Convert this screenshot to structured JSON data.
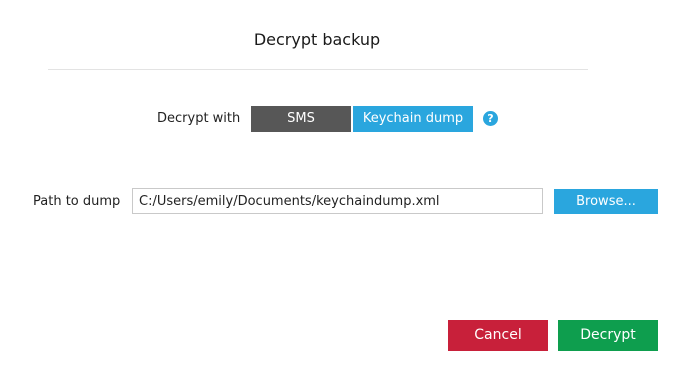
{
  "dialog": {
    "title": "Decrypt backup"
  },
  "decrypt_with": {
    "label": "Decrypt with",
    "options": [
      {
        "label": "SMS",
        "selected": false
      },
      {
        "label": "Keychain dump",
        "selected": true
      }
    ],
    "help_icon": "question-mark-icon",
    "help_glyph": "?"
  },
  "path": {
    "label": "Path to dump",
    "value": "C:/Users/emily/Documents/keychaindump.xml",
    "browse_label": "Browse..."
  },
  "footer": {
    "cancel_label": "Cancel",
    "decrypt_label": "Decrypt"
  },
  "colors": {
    "accent_blue": "#2aa6de",
    "segment_inactive": "#575757",
    "cancel_red": "#c8203a",
    "decrypt_green": "#0e9e4e"
  }
}
